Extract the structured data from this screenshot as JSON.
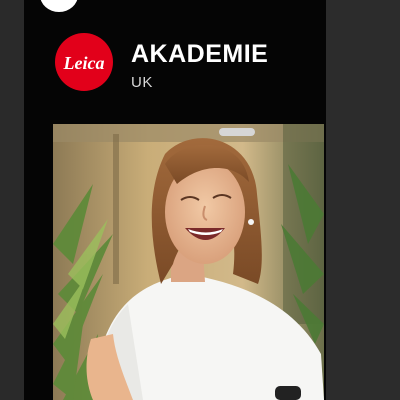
{
  "profile": {
    "logo_text": "Leica",
    "title": "AKADEMIE",
    "subtitle": "UK"
  },
  "colors": {
    "background": "#050505",
    "brand_red": "#e2001a",
    "title_text": "#ffffff"
  },
  "icons": {
    "logo": "leica-logo-icon",
    "top_avatar": "avatar-circle-icon"
  }
}
